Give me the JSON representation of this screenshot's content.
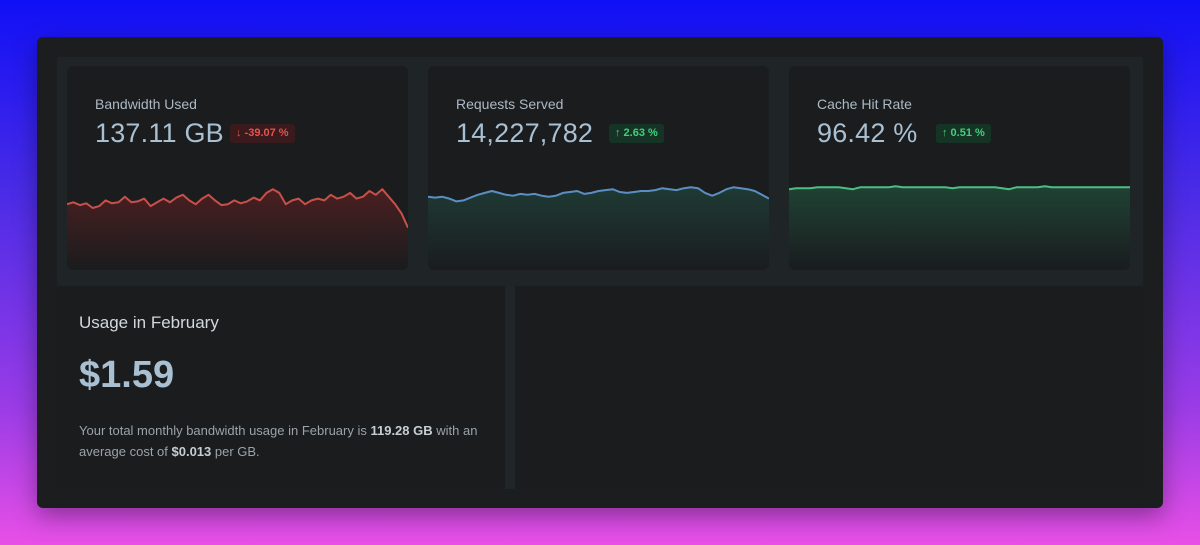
{
  "cards": [
    {
      "label": "Bandwidth Used",
      "value": "137.11 GB",
      "badge": "↓ -39.07 %",
      "trend": "down",
      "color": "#c8504a",
      "fill": "#4a1f20",
      "series": [
        70,
        72,
        69,
        71,
        66,
        68,
        74,
        71,
        72,
        78,
        72,
        73,
        76,
        68,
        72,
        76,
        72,
        77,
        80,
        74,
        70,
        76,
        80,
        74,
        69,
        70,
        74,
        71,
        73,
        77,
        74,
        82,
        86,
        82,
        70,
        74,
        76,
        70,
        74,
        76,
        74,
        80,
        76,
        78,
        82,
        76,
        78,
        84,
        80,
        86,
        78,
        70,
        60,
        45
      ]
    },
    {
      "label": "Requests Served",
      "value": "14,227,782",
      "badge": "↑ 2.63 %",
      "trend": "up",
      "color": "#5b8fc4",
      "fill": "#1f3a34",
      "series": [
        78,
        77,
        78,
        76,
        73,
        74,
        77,
        80,
        82,
        84,
        82,
        80,
        79,
        81,
        80,
        81,
        79,
        78,
        79,
        82,
        83,
        84,
        81,
        82,
        84,
        85,
        86,
        83,
        82,
        83,
        84,
        84,
        85,
        87,
        86,
        85,
        87,
        88,
        87,
        82,
        79,
        82,
        86,
        88,
        87,
        86,
        84,
        80,
        76
      ]
    },
    {
      "label": "Cache Hit Rate",
      "value": "96.42 %",
      "badge": "↑ 0.51 %",
      "trend": "up",
      "color": "#4bbf83",
      "fill": "#1f4234",
      "series": [
        86,
        87,
        87,
        87,
        88,
        88,
        88,
        88,
        87,
        86,
        88,
        88,
        88,
        88,
        88,
        89,
        88,
        88,
        88,
        88,
        88,
        88,
        88,
        87,
        88,
        88,
        88,
        88,
        88,
        88,
        87,
        86,
        88,
        88,
        88,
        88,
        89,
        88,
        88,
        88,
        88,
        88,
        88,
        88,
        88,
        88,
        88,
        88,
        88
      ]
    }
  ],
  "usage": {
    "title": "Usage in February",
    "amount": "$1.59",
    "desc_prefix": "Your total monthly bandwidth usage in February is ",
    "desc_gb": "119.28 GB",
    "desc_mid": " with an average cost of ",
    "desc_cost": "$0.013",
    "desc_suffix": " per GB."
  }
}
